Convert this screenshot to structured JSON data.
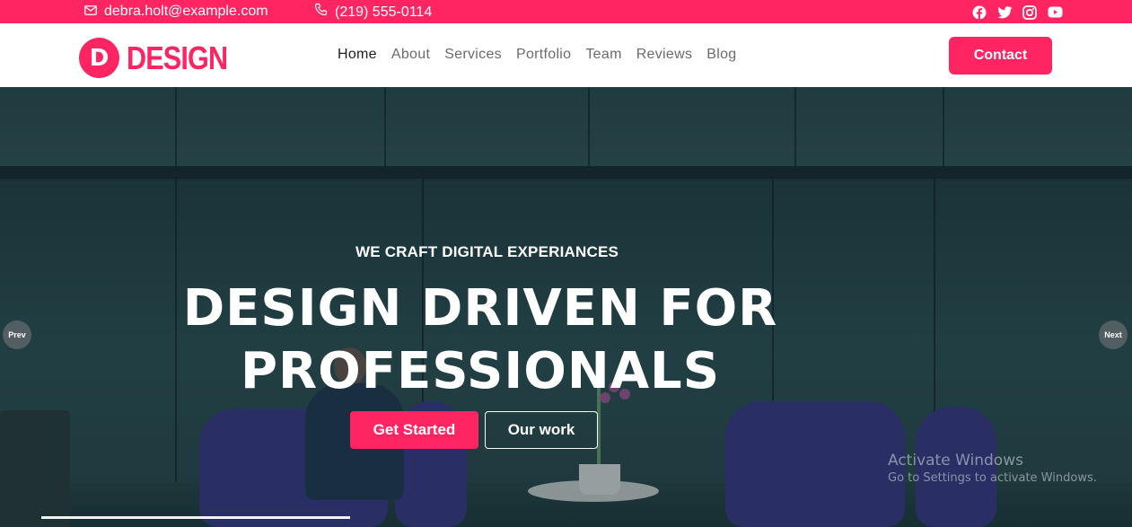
{
  "topbar": {
    "email": "debra.holt@example.com",
    "phone": "(219) 555-0114",
    "email_icon": "envelope-icon",
    "phone_icon": "phone-icon",
    "socials": [
      "facebook-icon",
      "twitter-icon",
      "instagram-icon",
      "youtube-icon"
    ]
  },
  "header": {
    "logo_letter": "D",
    "logo_text": "DESIGN",
    "nav": [
      {
        "label": "Home",
        "active": true
      },
      {
        "label": "About",
        "active": false
      },
      {
        "label": "Services",
        "active": false
      },
      {
        "label": "Portfolio",
        "active": false
      },
      {
        "label": "Team",
        "active": false
      },
      {
        "label": "Reviews",
        "active": false
      },
      {
        "label": "Blog",
        "active": false
      }
    ],
    "contact_label": "Contact"
  },
  "hero": {
    "eyebrow": "WE CRAFT DIGITAL EXPERIANCES",
    "headline_line1": "DESIGN DRIVEN FOR",
    "headline_line2": "PROFESSIONALS",
    "primary_label": "Get Started",
    "secondary_label": "Our work",
    "prev_label": "Prev",
    "next_label": "Next"
  },
  "watermark": {
    "title": "Activate Windows",
    "subtitle": "Go to Settings to activate Windows."
  },
  "colors": {
    "accent": "#ff2462",
    "hero_bg": "#2f5157"
  }
}
